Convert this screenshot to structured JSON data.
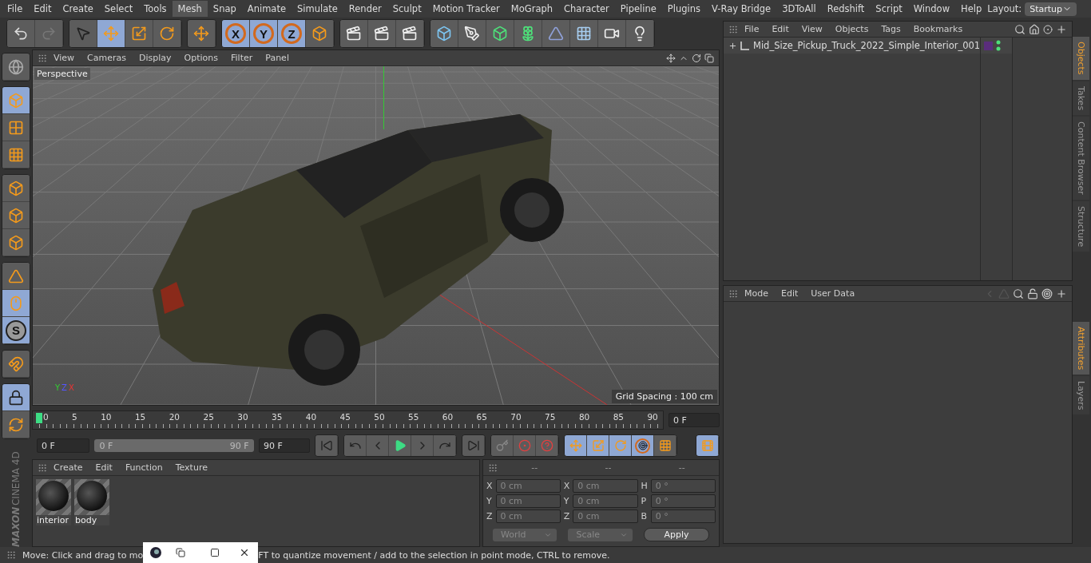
{
  "menu_bar": {
    "items": [
      {
        "label": "File",
        "selected": false
      },
      {
        "label": "Edit",
        "selected": false
      },
      {
        "label": "Create",
        "selected": false
      },
      {
        "label": "Select",
        "selected": false
      },
      {
        "label": "Tools",
        "selected": false
      },
      {
        "label": "Mesh",
        "selected": true
      },
      {
        "label": "Snap",
        "selected": false
      },
      {
        "label": "Animate",
        "selected": false
      },
      {
        "label": "Simulate",
        "selected": false
      },
      {
        "label": "Render",
        "selected": false
      },
      {
        "label": "Sculpt",
        "selected": false
      },
      {
        "label": "Motion Tracker",
        "selected": false
      },
      {
        "label": "MoGraph",
        "selected": false
      },
      {
        "label": "Character",
        "selected": false
      },
      {
        "label": "Pipeline",
        "selected": false
      },
      {
        "label": "Plugins",
        "selected": false
      },
      {
        "label": "V-Ray Bridge",
        "selected": false
      },
      {
        "label": "3DToAll",
        "selected": false
      },
      {
        "label": "Redshift",
        "selected": false
      },
      {
        "label": "Script",
        "selected": false
      },
      {
        "label": "Window",
        "selected": false
      },
      {
        "label": "Help",
        "selected": false
      }
    ],
    "layout_label": "Layout:",
    "layout_value": "Startup"
  },
  "toolbar": {
    "groups": [
      {
        "buttons": [
          {
            "selected": false
          },
          {
            "selected": false,
            "disabled": true
          }
        ]
      },
      {
        "buttons": [
          {
            "selected": false
          },
          {
            "selected": true
          },
          {
            "selected": false
          },
          {
            "selected": false
          }
        ]
      },
      {
        "buttons": [
          {
            "selected": false
          }
        ]
      },
      {
        "buttons": [
          {
            "selected": true,
            "label": "X"
          },
          {
            "selected": true,
            "label": "Y"
          },
          {
            "selected": true,
            "label": "Z"
          },
          {
            "selected": false
          }
        ]
      },
      {
        "buttons": [
          {
            "selected": false
          },
          {
            "selected": false
          },
          {
            "selected": false
          }
        ]
      },
      {
        "buttons": [
          {
            "selected": false
          },
          {
            "selected": false
          },
          {
            "selected": false
          },
          {
            "selected": false
          },
          {
            "selected": false
          },
          {
            "selected": false
          },
          {
            "selected": false
          },
          {
            "selected": false
          }
        ]
      }
    ]
  },
  "left_toolbar": {
    "groups": [
      {
        "buttons": [
          {
            "selected": false
          }
        ]
      },
      {
        "buttons": [
          {
            "selected": true
          },
          {
            "selected": false
          },
          {
            "selected": false
          }
        ]
      },
      {
        "buttons": [
          {
            "selected": false
          },
          {
            "selected": false
          },
          {
            "selected": false
          }
        ]
      },
      {
        "buttons": [
          {
            "selected": false
          },
          {
            "selected": true
          },
          {
            "selected": true,
            "label": "S"
          }
        ]
      },
      {
        "buttons": [
          {
            "selected": false
          }
        ]
      },
      {
        "buttons": [
          {
            "selected": true
          },
          {
            "selected": false
          }
        ]
      }
    ]
  },
  "brand": {
    "maker": "MAXON",
    "product": "CINEMA 4D"
  },
  "viewport": {
    "menu": [
      "View",
      "Cameras",
      "Display",
      "Options",
      "Filter",
      "Panel"
    ],
    "camera_label": "Perspective",
    "grid_spacing": "Grid Spacing : 100 cm",
    "axis_labels": [
      "Y",
      "Z",
      "X"
    ]
  },
  "timeline": {
    "ticks": [
      "0",
      "5",
      "10",
      "15",
      "20",
      "25",
      "30",
      "35",
      "40",
      "45",
      "50",
      "55",
      "60",
      "65",
      "70",
      "75",
      "80",
      "85",
      "90"
    ],
    "level": 0,
    "current_frame": "0 F"
  },
  "playback": {
    "start_frame": "0 F",
    "range": {
      "start": "0 F",
      "end": "90 F",
      "level": 1
    },
    "end_frame": "90 F"
  },
  "materials": {
    "menu": [
      "Create",
      "Edit",
      "Function",
      "Texture"
    ],
    "items": [
      {
        "name": "interior"
      },
      {
        "name": "body"
      }
    ]
  },
  "coordinates": {
    "headers": [
      "--",
      "--",
      "--"
    ],
    "rows": [
      [
        {
          "label": "X",
          "value": "0 cm"
        },
        {
          "label": "X",
          "value": "0 cm"
        },
        {
          "label": "H",
          "value": "0 °"
        }
      ],
      [
        {
          "label": "Y",
          "value": "0 cm"
        },
        {
          "label": "Y",
          "value": "0 cm"
        },
        {
          "label": "P",
          "value": "0 °"
        }
      ],
      [
        {
          "label": "Z",
          "value": "0 cm"
        },
        {
          "label": "Z",
          "value": "0 cm"
        },
        {
          "label": "B",
          "value": "0 °"
        }
      ]
    ],
    "space": "World",
    "mode": "Scale",
    "apply": "Apply"
  },
  "objects_panel": {
    "menu": [
      "File",
      "Edit",
      "View",
      "Objects",
      "Tags",
      "Bookmarks"
    ],
    "objects": [
      {
        "name": "Mid_Size_Pickup_Truck_2022_Simple_Interior_001",
        "expanded": false,
        "color": "#5a2d7c"
      }
    ]
  },
  "attributes_panel": {
    "menu": [
      "Mode",
      "Edit",
      "User Data"
    ]
  },
  "side_tabs_top": [
    {
      "label": "Objects",
      "selected": true
    },
    {
      "label": "Takes",
      "selected": false
    },
    {
      "label": "Content Browser",
      "selected": false
    },
    {
      "label": "Structure",
      "selected": false
    }
  ],
  "side_tabs_bottom": [
    {
      "label": "Attributes",
      "selected": true
    },
    {
      "label": "Layers",
      "selected": false
    }
  ],
  "status_bar": {
    "text_before": "Move: Click and drag to mo",
    "text_after": "FT to quantize movement / add to the selection in point mode, CTRL to remove."
  }
}
